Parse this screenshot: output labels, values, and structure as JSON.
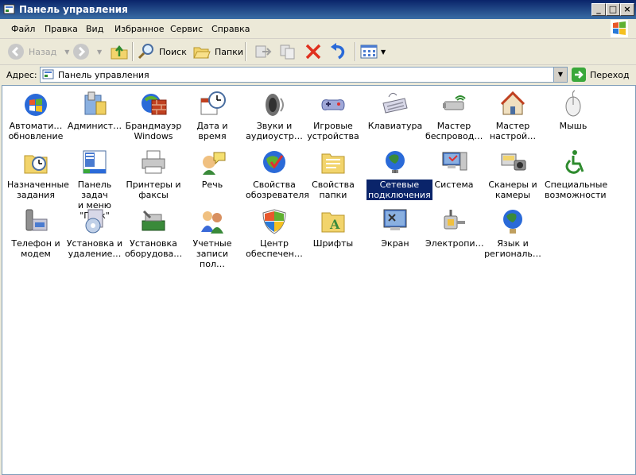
{
  "window": {
    "title": "Панель управления"
  },
  "menu": [
    "Файл",
    "Правка",
    "Вид",
    "Избранное",
    "Сервис",
    "Справка"
  ],
  "toolbar": {
    "back": "Назад",
    "search": "Поиск",
    "folders": "Папки"
  },
  "address": {
    "label": "Адрес:",
    "value": "Панель управления",
    "go": "Переход"
  },
  "items": [
    {
      "label": "Автомати…\nобновление",
      "icon": "windows-update-icon"
    },
    {
      "label": "Админист…",
      "icon": "administrative-tools-icon"
    },
    {
      "label": "Брандмауэр\nWindows",
      "icon": "firewall-icon"
    },
    {
      "label": "Дата и время",
      "icon": "clock-icon"
    },
    {
      "label": "Звуки и\nаудиоустр…",
      "icon": "speaker-icon"
    },
    {
      "label": "Игровые\nустройства",
      "icon": "gamepad-icon"
    },
    {
      "label": "Клавиатура",
      "icon": "keyboard-icon"
    },
    {
      "label": "Мастер\nбеспровод…",
      "icon": "wireless-icon"
    },
    {
      "label": "Мастер\nнастрой…",
      "icon": "home-network-icon"
    },
    {
      "label": "Мышь",
      "icon": "mouse-icon"
    },
    {
      "label": "Назначенные\nзадания",
      "icon": "scheduled-tasks-icon"
    },
    {
      "label": "Панель задач\nи меню \"Пуск\"",
      "icon": "taskbar-icon"
    },
    {
      "label": "Принтеры и\nфаксы",
      "icon": "printer-icon"
    },
    {
      "label": "Речь",
      "icon": "speech-icon"
    },
    {
      "label": "Свойства\nобозревателя",
      "icon": "internet-options-icon"
    },
    {
      "label": "Свойства\nпапки",
      "icon": "folder-options-icon"
    },
    {
      "label": "Сетевые\nподключения",
      "icon": "network-connections-icon",
      "selected": true
    },
    {
      "label": "Система",
      "icon": "system-icon"
    },
    {
      "label": "Сканеры и\nкамеры",
      "icon": "scanner-icon"
    },
    {
      "label": "Специальные\nвозможности",
      "icon": "accessibility-icon"
    },
    {
      "label": "Телефон и\nмодем",
      "icon": "phone-icon"
    },
    {
      "label": "Установка и\nудаление…",
      "icon": "add-remove-icon"
    },
    {
      "label": "Установка\nоборудова…",
      "icon": "add-hardware-icon"
    },
    {
      "label": "Учетные\nзаписи пол…",
      "icon": "user-accounts-icon"
    },
    {
      "label": "Центр\nобеспечен…",
      "icon": "security-center-icon"
    },
    {
      "label": "Шрифты",
      "icon": "fonts-icon"
    },
    {
      "label": "Экран",
      "icon": "display-icon"
    },
    {
      "label": "Электропи…",
      "icon": "power-icon"
    },
    {
      "label": "Язык и\nрегиональ…",
      "icon": "language-icon"
    }
  ]
}
